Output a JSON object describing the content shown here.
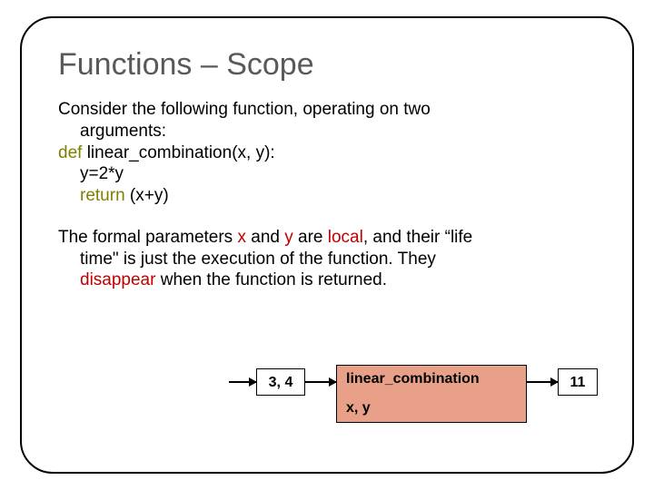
{
  "title": "Functions – Scope",
  "para1": {
    "line1a": "Consider the following function, operating on two",
    "line1b": "arguments:",
    "def": "def",
    "fname": " linear_combination(x, y):",
    "body1": "y=2*y",
    "ret": "return",
    "retexpr": " (x+y)"
  },
  "para2": {
    "t1": "The formal parameters ",
    "x": "x",
    "t2": " and ",
    "y": "y",
    "t3": " are ",
    "local": "local",
    "t4": ", and their “life",
    "line2a": "time\" is just the execution of the function. They",
    "disappear": "disappear",
    "line3b": " when the function is returned."
  },
  "diagram": {
    "input": "3, 4",
    "func_name": "linear_combination",
    "params": "x, y",
    "output": "11"
  }
}
